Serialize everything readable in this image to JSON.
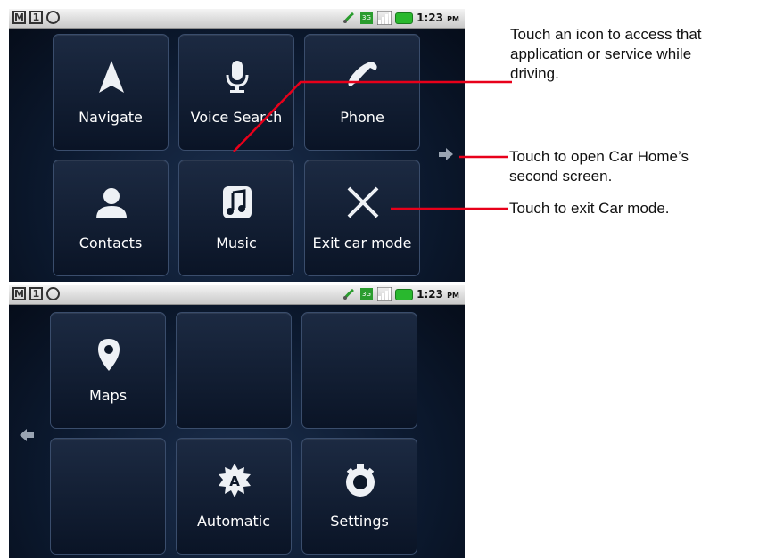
{
  "status_bar": {
    "notif_icons": [
      "gmail-icon",
      "calendar-icon",
      "car-dock-icon"
    ],
    "time": "1:23",
    "ampm": "PM",
    "network_label": "3G"
  },
  "screen1": {
    "tiles": [
      {
        "label": "Navigate",
        "icon": "navigation-arrow-icon"
      },
      {
        "label": "Voice Search",
        "icon": "microphone-icon"
      },
      {
        "label": "Phone",
        "icon": "phone-handset-icon"
      },
      {
        "label": "Contacts",
        "icon": "person-icon"
      },
      {
        "label": "Music",
        "icon": "music-note-icon"
      },
      {
        "label": "Exit car mode",
        "icon": "close-x-icon"
      }
    ],
    "next_arrow": "arrow-right-icon"
  },
  "screen2": {
    "tiles": [
      {
        "label": "Maps",
        "icon": "map-pin-icon"
      },
      {
        "label": "",
        "icon": ""
      },
      {
        "label": "",
        "icon": ""
      },
      {
        "label": "",
        "icon": ""
      },
      {
        "label": "Automatic",
        "icon": "auto-brightness-icon"
      },
      {
        "label": "Settings",
        "icon": "settings-gear-icon"
      }
    ],
    "prev_arrow": "arrow-left-icon"
  },
  "callouts": {
    "apps": "Touch an icon to access that application or service while driving.",
    "apps_line1": "Touch an icon to access that",
    "apps_line2": "application or service while",
    "apps_line3": "driving.",
    "second_screen_line1": "Touch to open Car Home’s",
    "second_screen_line2": "second screen.",
    "exit": "Touch to exit Car mode."
  },
  "colors": {
    "callout_line": "#e8001a",
    "tile_border": "#3a4d6c",
    "battery": "#29b82e"
  }
}
